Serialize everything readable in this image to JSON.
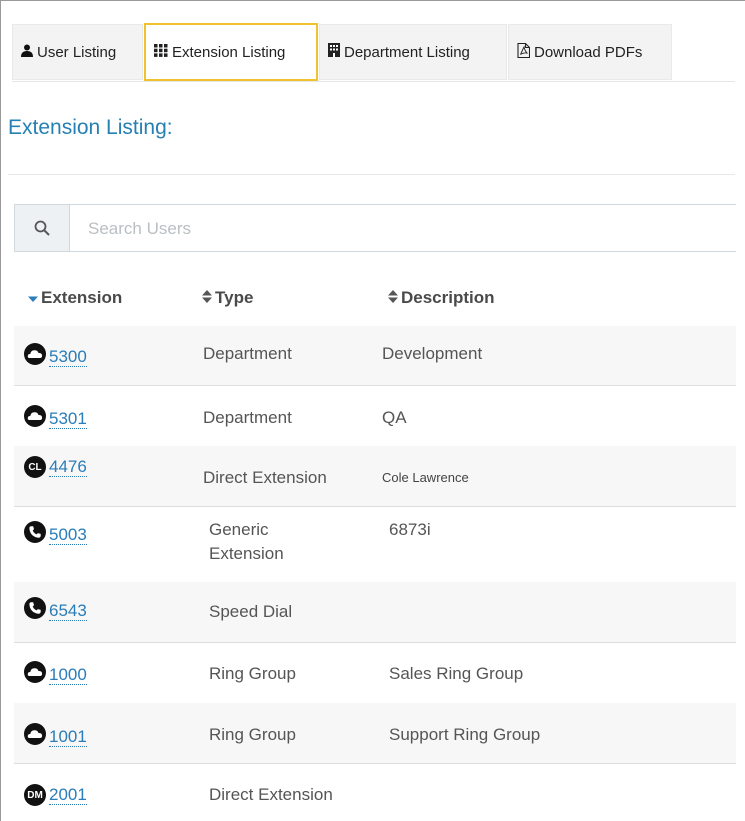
{
  "tabs": [
    {
      "label": "User Listing",
      "icon": "user-icon",
      "active": false
    },
    {
      "label": "Extension Listing",
      "icon": "grid-icon",
      "active": true
    },
    {
      "label": "Department Listing",
      "icon": "building-icon",
      "active": false
    },
    {
      "label": "Download PDFs",
      "icon": "pdf-icon",
      "active": false
    }
  ],
  "page_title": "Extension Listing:",
  "search": {
    "placeholder": "Search Users",
    "value": ""
  },
  "table": {
    "headers": {
      "extension": "Extension",
      "type": "Type",
      "description": "Description"
    },
    "rows": [
      {
        "icon": "cloud",
        "extension": "5300",
        "type": "Department",
        "description": "Development"
      },
      {
        "icon": "cloud",
        "extension": "5301",
        "type": "Department",
        "description": "QA"
      },
      {
        "icon": "initials",
        "initials": "CL",
        "extension": "4476",
        "type": "Direct Extension",
        "description": "Cole Lawrence"
      },
      {
        "icon": "phone",
        "extension": "5003",
        "type": "Generic Extension",
        "type_lines": [
          "Generic",
          "Extension"
        ],
        "description": "6873i"
      },
      {
        "icon": "phone",
        "extension": "6543",
        "type": "Speed Dial",
        "description": ""
      },
      {
        "icon": "cloud",
        "extension": "1000",
        "type": "Ring Group",
        "description": "Sales Ring Group"
      },
      {
        "icon": "cloud",
        "extension": "1001",
        "type": "Ring Group",
        "description": "Support Ring Group"
      },
      {
        "icon": "initials",
        "initials": "DM",
        "extension": "2001",
        "type": "Direct Extension",
        "description": ""
      }
    ]
  },
  "colors": {
    "accent": "#2680b4",
    "active_tab_border": "#f2c12e",
    "link": "#2a7db8"
  }
}
